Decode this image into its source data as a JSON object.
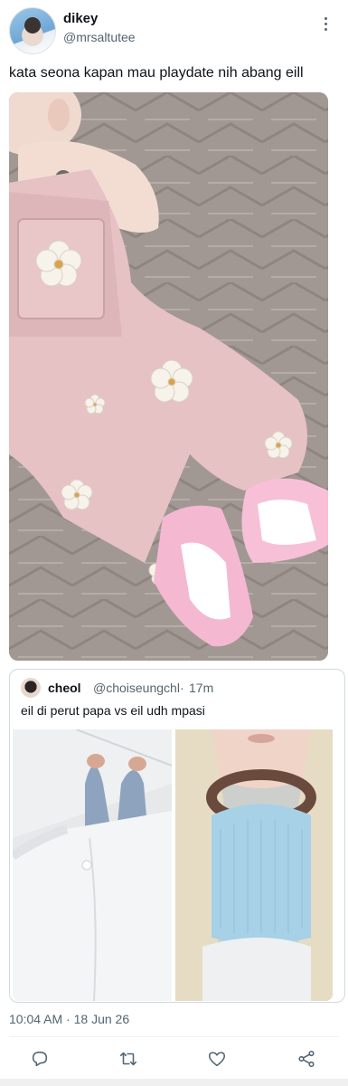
{
  "tweet": {
    "display_name": "dikey",
    "handle": "@mrsaltutee",
    "text": "kata seona kapan mau playdate nih abang eill",
    "timestamp_time": "10:04 AM",
    "timestamp_sep": "·",
    "timestamp_date": "18 Jun 26"
  },
  "quote": {
    "display_name": "cheol",
    "handle": "@choiseungchl",
    "separator": "·",
    "time": "17m",
    "text": "eil di perut papa vs eil udh mpasi"
  },
  "icons": {
    "more": "more-vertical-icon",
    "reply": "reply-icon",
    "retweet": "retweet-icon",
    "like": "heart-icon",
    "share": "share-icon"
  },
  "colors": {
    "text_primary": "#0f1419",
    "text_secondary": "#536471",
    "border": "#cfd9de"
  }
}
